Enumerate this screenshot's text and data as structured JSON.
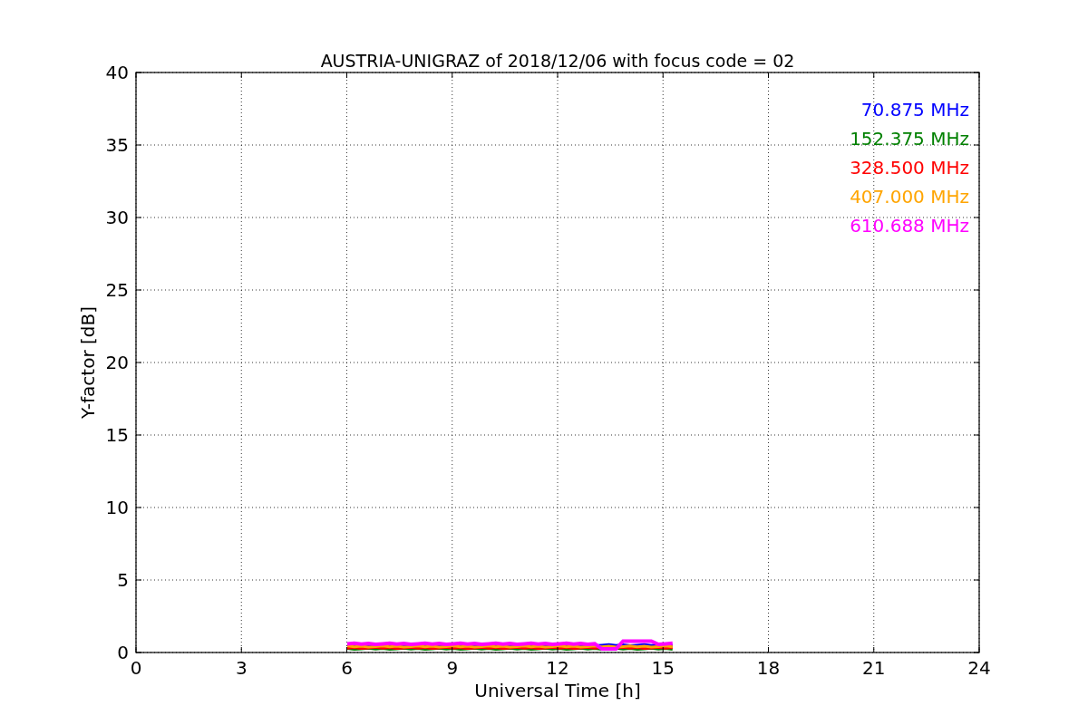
{
  "chart_data": {
    "type": "line",
    "title": "AUSTRIA-UNIGRAZ of 2018/12/06 with focus code = 02",
    "xlabel": "Universal Time [h]",
    "ylabel": "Y-factor [dB]",
    "xlim": [
      0,
      24
    ],
    "ylim": [
      0,
      40
    ],
    "xticks": [
      0,
      3,
      6,
      9,
      12,
      15,
      18,
      21,
      24
    ],
    "yticks": [
      0,
      5,
      10,
      15,
      20,
      25,
      30,
      35,
      40
    ],
    "grid": true
  },
  "legend": [
    {
      "label": "70.875 MHz",
      "color": "#0000ff"
    },
    {
      "label": "152.375 MHz",
      "color": "#008000"
    },
    {
      "label": "328.500 MHz",
      "color": "#ff0000"
    },
    {
      "label": "407.000 MHz",
      "color": "#ffa500"
    },
    {
      "label": "610.688 MHz",
      "color": "#ff00ff"
    }
  ]
}
